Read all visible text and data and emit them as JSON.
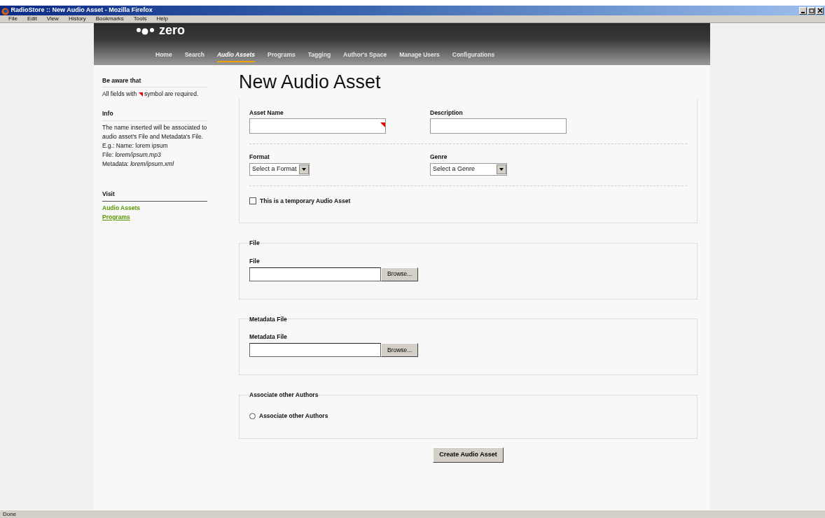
{
  "window": {
    "title": "RadioStore :: New Audio Asset - Mozilla Firefox"
  },
  "menu": [
    "File",
    "Edit",
    "View",
    "History",
    "Bookmarks",
    "Tools",
    "Help"
  ],
  "site": {
    "logo": "zero",
    "nav": [
      {
        "label": "Home",
        "selected": false
      },
      {
        "label": "Search",
        "selected": false
      },
      {
        "label": "Audio Assets",
        "selected": true
      },
      {
        "label": "Programs",
        "selected": false
      },
      {
        "label": "Tagging",
        "selected": false
      },
      {
        "label": "Author's Space",
        "selected": false
      },
      {
        "label": "Manage Users",
        "selected": false
      },
      {
        "label": "Configurations",
        "selected": false
      }
    ]
  },
  "sidebar": {
    "aware": {
      "heading": "Be aware that",
      "text_before": "All fields with",
      "text_after": "symbol are required."
    },
    "info": {
      "heading": "Info",
      "lines": [
        "The name inserted will be associated to audio asset's File and Metadata's File.",
        "E.g.: Name: lorem ipsum",
        "File: *lorem/ipsum.mp3*",
        "Metadata: *lorem/ipsum.xml*"
      ]
    },
    "visit": {
      "heading": "Visit",
      "links": [
        {
          "label": "Audio Assets",
          "underlined": false
        },
        {
          "label": "Programs",
          "underlined": true
        }
      ]
    }
  },
  "form": {
    "title": "New Audio Asset",
    "sections": [
      {
        "kind": "fields",
        "rows": [
          {
            "fields": [
              {
                "kind": "text",
                "label": "Asset Name",
                "required": true
              },
              {
                "kind": "text",
                "label": "Description",
                "required": false
              }
            ]
          },
          {
            "fields": [
              {
                "kind": "select",
                "label": "Format",
                "value": "Select a Format"
              },
              {
                "kind": "select",
                "label": "Genre",
                "value": "Select a Genre"
              }
            ]
          },
          {
            "fields": [
              {
                "kind": "checkbox",
                "label": "This is a temporary Audio Asset",
                "checked": false
              }
            ]
          }
        ]
      },
      {
        "kind": "file",
        "legend": "File",
        "label": "File",
        "button": "Browse..."
      },
      {
        "kind": "file",
        "legend": "Metadata File",
        "label": "Metadata File",
        "button": "Browse..."
      },
      {
        "kind": "radio",
        "legend": "Associate other Authors",
        "label": "Associate other Authors",
        "selected": false
      }
    ],
    "submit": "Create Audio Asset"
  },
  "status_bar": "Done"
}
